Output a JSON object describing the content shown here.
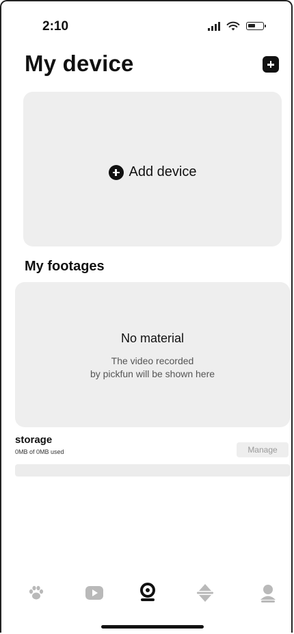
{
  "status_bar": {
    "time": "2:10"
  },
  "header": {
    "title": "My device"
  },
  "device_card": {
    "add_label": "Add device"
  },
  "footages": {
    "title": "My footages",
    "empty_title": "No material",
    "empty_line1": "The video recorded",
    "empty_line2": "by pickfun will be shown here"
  },
  "storage": {
    "title": "storage",
    "used_text": "0MB of 0MB used",
    "manage_label": "Manage",
    "used_fraction": 0
  },
  "tab_bar": {
    "tabs": [
      {
        "icon": "paw-icon",
        "active": false
      },
      {
        "icon": "play-icon",
        "active": false
      },
      {
        "icon": "camera-icon",
        "active": true
      },
      {
        "icon": "globe-icon",
        "active": false
      },
      {
        "icon": "profile-icon",
        "active": false
      }
    ]
  },
  "colors": {
    "active_tab": "#111111",
    "inactive_tab": "#b9b9b9",
    "card_bg": "#eeeeee"
  }
}
